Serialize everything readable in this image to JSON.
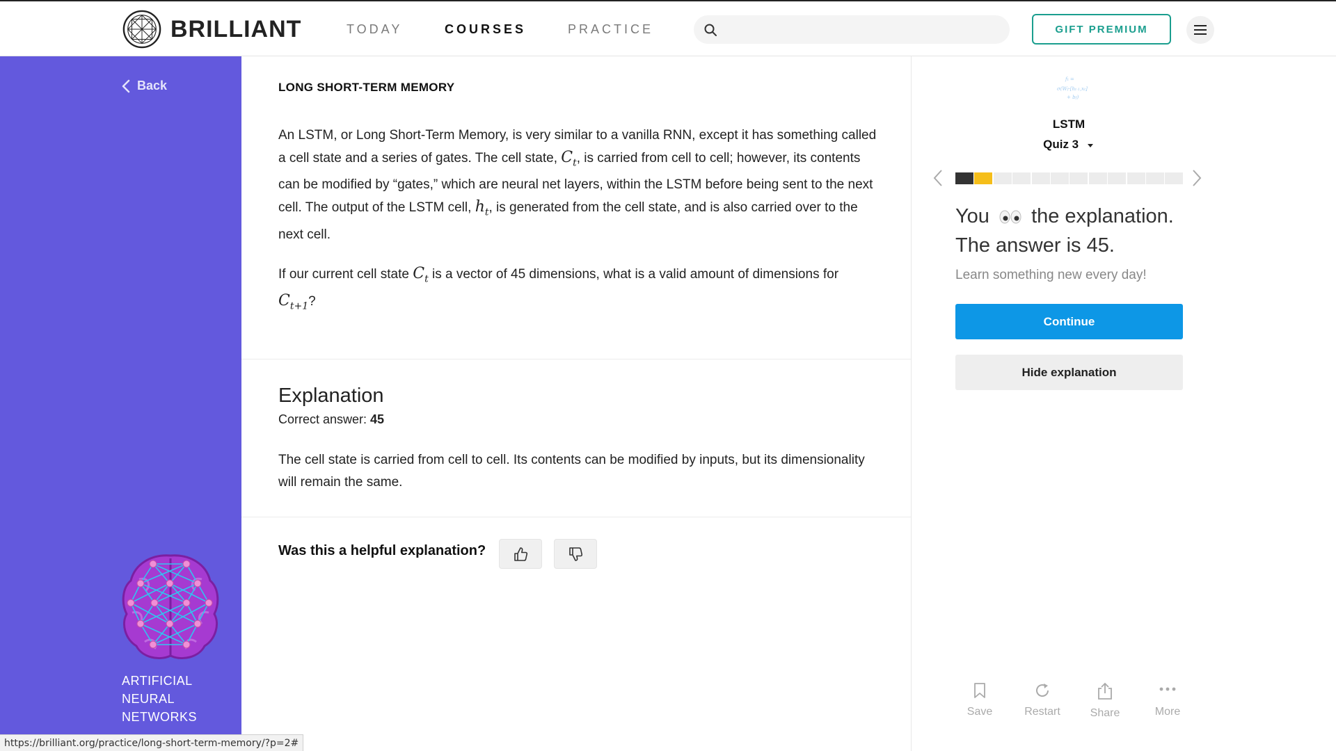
{
  "header": {
    "logo_text": "BRILLIANT",
    "nav": {
      "today": "TODAY",
      "courses": "COURSES",
      "practice": "PRACTICE"
    },
    "search_placeholder": "",
    "gift_label": "GIFT PREMIUM",
    "icons": {
      "search": "search-icon",
      "menu": "hamburger-icon",
      "logo": "brilliant-logo-icon"
    }
  },
  "sidebar": {
    "back_label": "Back",
    "course_name_lines": [
      "ARTIFICIAL",
      "NEURAL",
      "NETWORKS"
    ],
    "background": "#6359dd"
  },
  "problem": {
    "title": "LONG SHORT-TERM MEMORY",
    "p1_a": "An LSTM, or Long Short-Term Memory, is very similar to a vanilla RNN, except it has something called a cell state and a series of gates. The cell state, ",
    "p1_b": ", is carried from cell to cell; however, its contents can be modified by “gates,” which are neural net layers, within the LSTM before being sent to the next cell. The output of the LSTM cell, ",
    "p1_c": ", is generated from the cell state, and is also carried over to the next cell.",
    "p2_a": "If our current cell state ",
    "p2_b": " is a vector of 45 dimensions, what is a valid amount of dimensions for ",
    "p2_c": "?",
    "math": {
      "C": "C",
      "t": "t",
      "h": "h",
      "t1": "t+1"
    }
  },
  "explanation": {
    "title": "Explanation",
    "answer_label": "Correct answer: ",
    "answer_value": "45",
    "text": "The cell state is carried from cell to cell. Its contents can be modified by inputs, but its dimensionality will remain the same."
  },
  "feedback": {
    "question": "Was this a helpful explanation?"
  },
  "quiz_panel": {
    "name": "LSTM",
    "quiz_label": "Quiz 3",
    "progress": {
      "total": 12,
      "completed": 1,
      "current_index": 2
    },
    "result_you": "You",
    "result_rest": "the explanation.",
    "result_line2": "The answer is 45.",
    "tagline": "Learn something new every day!",
    "continue_label": "Continue",
    "hide_label": "Hide explanation",
    "actions": {
      "save": "Save",
      "restart": "Restart",
      "share": "Share",
      "more": "More"
    },
    "colors": {
      "continue": "#0d97e6",
      "current_seg": "#f5be1a",
      "done_seg": "#333333"
    }
  },
  "status_bar": {
    "url": "https://brilliant.org/practice/long-short-term-memory/?p=2#"
  }
}
